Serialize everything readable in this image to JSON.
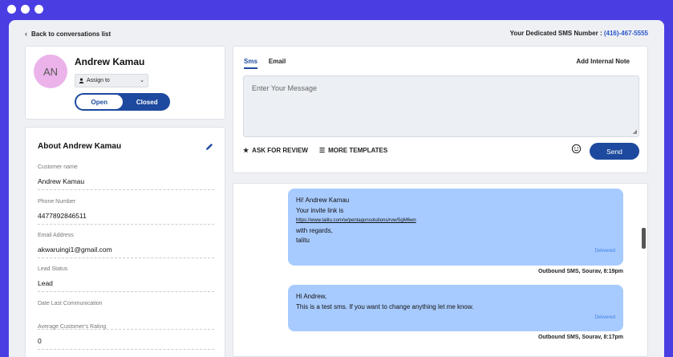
{
  "topbar": {
    "back_label": "Back to conversations list",
    "sms_number_label": "Your Dedicated SMS Number :",
    "sms_number": "(416)-467-5555"
  },
  "profile": {
    "initials": "AN",
    "name": "Andrew Kamau",
    "assign_label": "Assign to",
    "status_options": [
      "Open",
      "Closed"
    ],
    "selected_status": "Open"
  },
  "about": {
    "title": "About Andrew Kamau",
    "fields": [
      {
        "label": "Customer name",
        "value": "Andrew Kamau"
      },
      {
        "label": "Phone Number",
        "value": "4477892846511"
      },
      {
        "label": "Email Address",
        "value": "akwaruingi1@gmail.com"
      },
      {
        "label": "Lead Status",
        "value": "Lead"
      },
      {
        "label": "Date Last Communication",
        "value": ""
      },
      {
        "label": "Average Customer's Rating",
        "value": "0"
      }
    ]
  },
  "compose": {
    "tabs": [
      "Sms",
      "Email"
    ],
    "active_tab": "Sms",
    "internal_note": "Add Internal Note",
    "placeholder": "Enter Your Message",
    "ask_review": "ASK FOR REVIEW",
    "more_templates": "MORE TEMPLATES",
    "send": "Send"
  },
  "thread": {
    "messages": [
      {
        "lines": [
          "Hi! Andrew Kamau",
          "Your invite link is"
        ],
        "link": "https://www.talitu.com/w/pentagonsolutions/rvw/5gM6wn",
        "after": [
          "with regards,",
          "talitu"
        ],
        "status": "Delivered",
        "meta": "Outbound SMS, Sourav, 8:19pm"
      },
      {
        "lines": [
          "Hi Andrew,",
          "This is a test sms. If you want to change anything let me know."
        ],
        "status": "Delivered",
        "meta": "Outbound SMS, Sourav, 8:17pm"
      }
    ]
  },
  "colors": {
    "frame": "#4a3ee3",
    "primary": "#1d4a9e",
    "bubble": "#a8cbff",
    "avatar": "#ebb3ea"
  }
}
